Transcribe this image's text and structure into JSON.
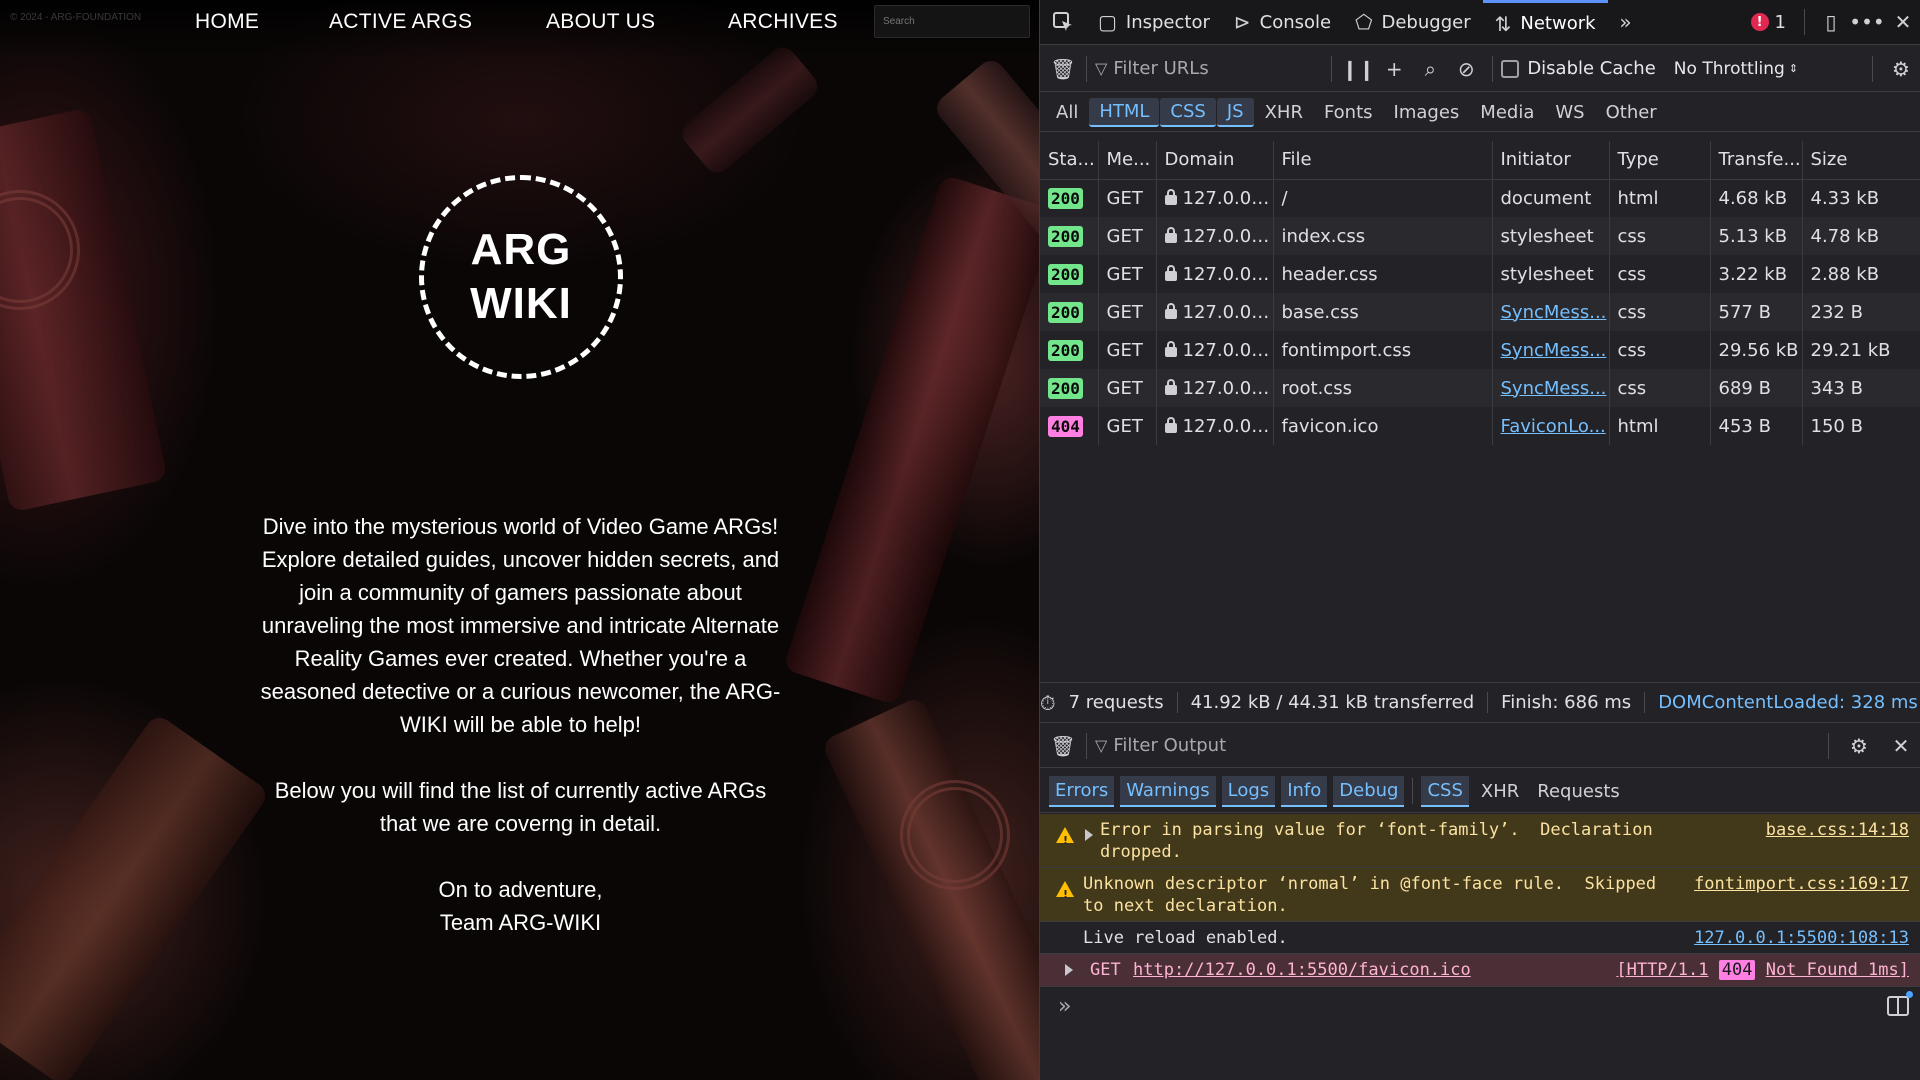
{
  "site": {
    "copyright": "© 2024 - ARG-FOUNDATION",
    "nav": {
      "home": "HOME",
      "active_args": "ACTIVE ARGS",
      "about_us": "ABOUT US",
      "archives": "ARCHIVES"
    },
    "search_placeholder": "Search",
    "logo_line1": "ARG",
    "logo_line2": "WIKI",
    "intro_paragraph": "Dive into the mysterious world of Video Game ARGs! Explore detailed guides, uncover hidden secrets, and join a community of gamers passionate about unraveling the most immersive and intricate Alternate Reality Games ever created. Whether you're a seasoned detective or a curious newcomer, the ARG-WIKI will be able to help!",
    "list_paragraph": "Below you will find the list of currently active ARGs that we are coverng in detail.",
    "signoff_line1": "On to adventure,",
    "signoff_line2": "Team ARG-WIKI"
  },
  "devtools": {
    "tabs": {
      "inspector": "Inspector",
      "console": "Console",
      "debugger": "Debugger",
      "network": "Network"
    },
    "error_count": "1",
    "network": {
      "filter_placeholder": "Filter URLs",
      "disable_cache": "Disable Cache",
      "throttling": "No Throttling",
      "type_filters": {
        "all": "All",
        "html": "HTML",
        "css": "CSS",
        "js": "JS",
        "xhr": "XHR",
        "fonts": "Fonts",
        "images": "Images",
        "media": "Media",
        "ws": "WS",
        "other": "Other"
      },
      "columns": {
        "status": "Sta...",
        "method": "Me...",
        "domain": "Domain",
        "file": "File",
        "initiator": "Initiator",
        "type": "Type",
        "transferred": "Transfe...",
        "size": "Size"
      },
      "rows": [
        {
          "status": "200",
          "method": "GET",
          "domain": "127.0.0....",
          "file": "/",
          "initiator": "document",
          "type": "html",
          "transferred": "4.68 kB",
          "size": "4.33 kB"
        },
        {
          "status": "200",
          "method": "GET",
          "domain": "127.0.0....",
          "file": "index.css",
          "initiator": "stylesheet",
          "type": "css",
          "transferred": "5.13 kB",
          "size": "4.78 kB"
        },
        {
          "status": "200",
          "method": "GET",
          "domain": "127.0.0....",
          "file": "header.css",
          "initiator": "stylesheet",
          "type": "css",
          "transferred": "3.22 kB",
          "size": "2.88 kB"
        },
        {
          "status": "200",
          "method": "GET",
          "domain": "127.0.0....",
          "file": "base.css",
          "initiator": "SyncMess...",
          "type": "css",
          "transferred": "577 B",
          "size": "232 B"
        },
        {
          "status": "200",
          "method": "GET",
          "domain": "127.0.0....",
          "file": "fontimport.css",
          "initiator": "SyncMess...",
          "type": "css",
          "transferred": "29.56 kB",
          "size": "29.21 kB"
        },
        {
          "status": "200",
          "method": "GET",
          "domain": "127.0.0....",
          "file": "root.css",
          "initiator": "SyncMess...",
          "type": "css",
          "transferred": "689 B",
          "size": "343 B"
        },
        {
          "status": "404",
          "method": "GET",
          "domain": "127.0.0....",
          "file": "favicon.ico",
          "initiator": "FaviconLo...",
          "type": "html",
          "transferred": "453 B",
          "size": "150 B"
        }
      ],
      "summary": {
        "requests": "7 requests",
        "transferred": "41.92 kB / 44.31 kB transferred",
        "finish": "Finish: 686 ms",
        "dom_loaded": "DOMContentLoaded: 328 ms"
      }
    },
    "console": {
      "filter_placeholder": "Filter Output",
      "filters": {
        "errors": "Errors",
        "warnings": "Warnings",
        "logs": "Logs",
        "info": "Info",
        "debug": "Debug",
        "css": "CSS",
        "xhr": "XHR",
        "requests": "Requests"
      },
      "messages": {
        "m1_line1": "Error in parsing value for ‘font-family’.  Declaration",
        "m1_line2": "dropped.",
        "m1_source": "base.css:14:18",
        "m2_line1": "Unknown descriptor ‘nromal’ in @font-face rule.  Skipped",
        "m2_line2": "to next declaration.",
        "m2_source": "fontimport.css:169:17",
        "m3_text": "Live reload enabled.",
        "m3_source": "127.0.0.1:5500:108:13",
        "m4_method": "GET",
        "m4_url": "http://127.0.0.1:5500/favicon.ico",
        "m4_status_pre": "[HTTP/1.1",
        "m4_status_code": "404",
        "m4_status_post": "Not Found 1ms]"
      }
    }
  }
}
